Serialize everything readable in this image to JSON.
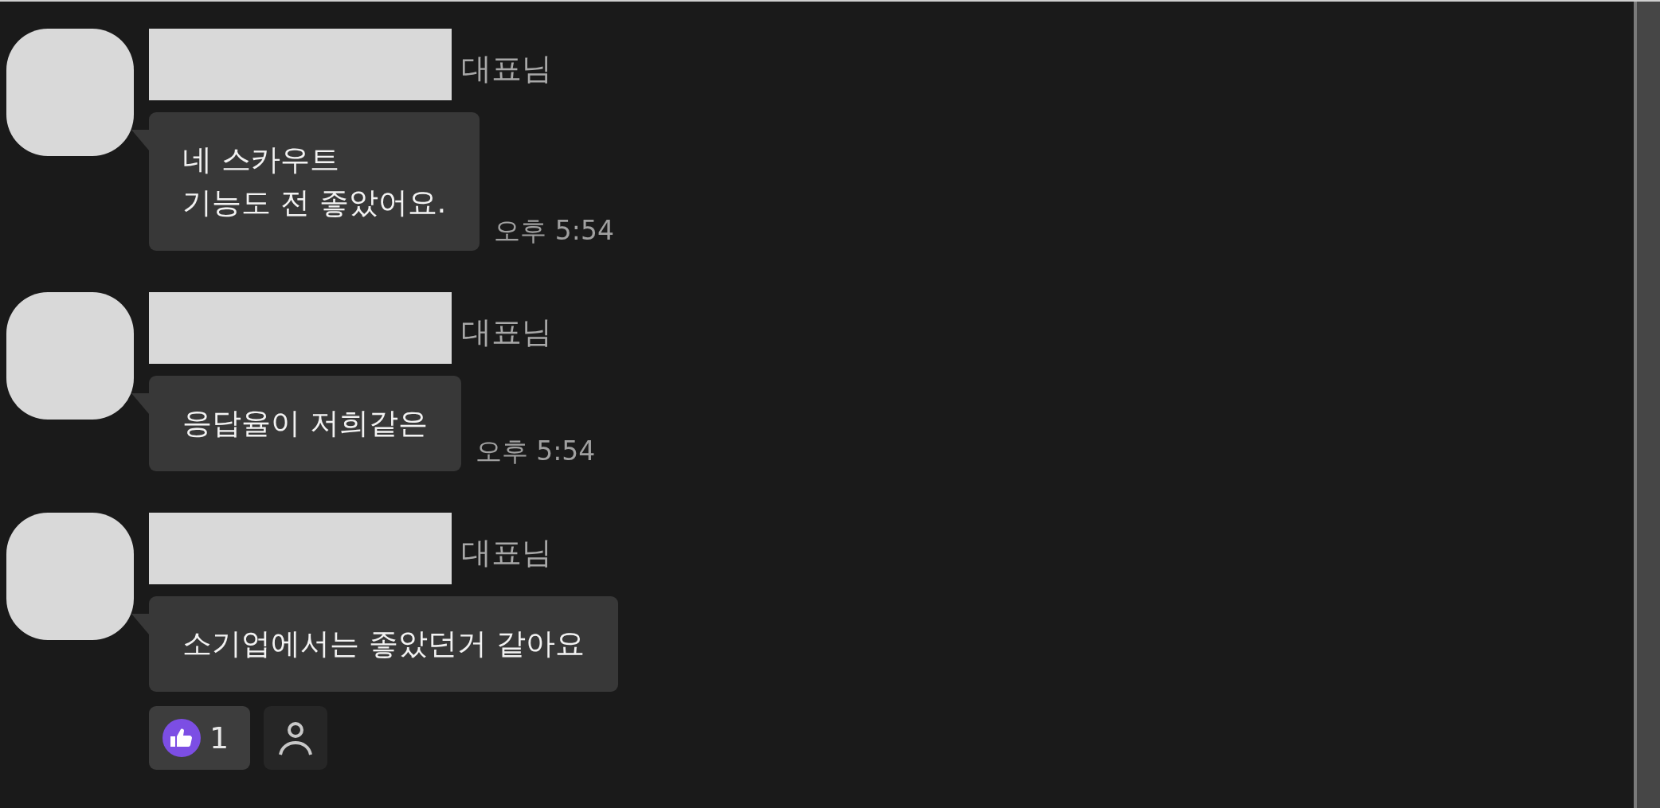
{
  "messages": [
    {
      "role": "대표님",
      "lines": [
        "네 스카우트",
        "기능도 전 좋았어요."
      ],
      "time": "오후 5:54"
    },
    {
      "role": "대표님",
      "lines": [
        "응답율이 저희같은"
      ],
      "time": "오후 5:54"
    },
    {
      "role": "대표님",
      "lines": [
        "소기업에서는 좋았던거 같아요"
      ],
      "reactions": [
        {
          "kind": "like",
          "count": "1"
        },
        {
          "kind": "add-person"
        }
      ]
    }
  ]
}
